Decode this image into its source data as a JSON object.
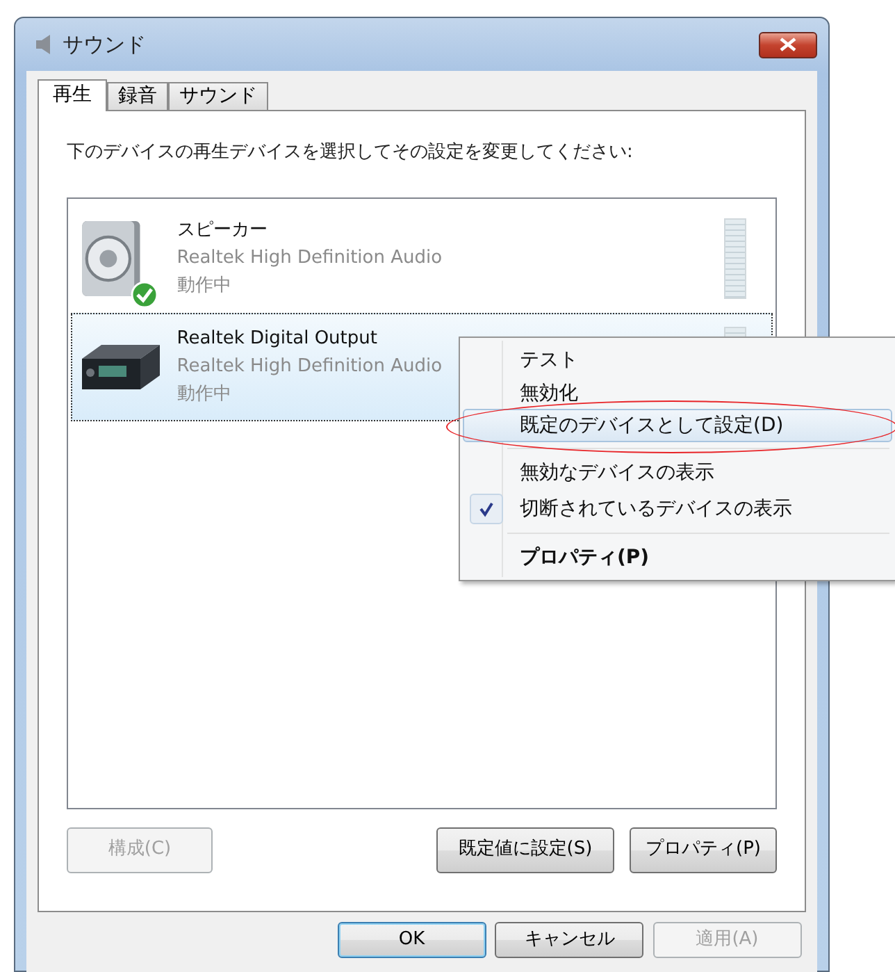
{
  "window": {
    "title": "サウンド"
  },
  "tabs": [
    {
      "label": "再生",
      "selected": true
    },
    {
      "label": "録音",
      "selected": false
    },
    {
      "label": "サウンド",
      "selected": false
    }
  ],
  "instruction": "下のデバイスの再生デバイスを選択してその設定を変更してください:",
  "devices": [
    {
      "kind": "speaker",
      "name": "スピーカー",
      "driver": "Realtek High Definition Audio",
      "status": "動作中",
      "default": true,
      "selected": false
    },
    {
      "kind": "digital-output",
      "name": "Realtek Digital Output",
      "driver": "Realtek High Definition Audio",
      "status": "動作中",
      "default": false,
      "selected": true
    }
  ],
  "device_buttons": [
    {
      "label": "構成(C)",
      "disabled": true
    },
    {
      "label": "既定値に設定(S)",
      "disabled": false
    },
    {
      "label": "プロパティ(P)",
      "disabled": false
    }
  ],
  "dialog_buttons": [
    {
      "label": "OK",
      "default": true,
      "disabled": false
    },
    {
      "label": "キャンセル",
      "default": false,
      "disabled": false
    },
    {
      "label": "適用(A)",
      "default": false,
      "disabled": true
    }
  ],
  "context_menu": {
    "items": [
      {
        "kind": "item",
        "label": "テスト",
        "highlighted": false,
        "circled": false,
        "checked": false,
        "bold": false
      },
      {
        "kind": "item",
        "label": "無効化",
        "highlighted": false,
        "circled": false,
        "checked": false,
        "bold": false
      },
      {
        "kind": "item",
        "label": "既定のデバイスとして設定(D)",
        "highlighted": true,
        "circled": true,
        "checked": false,
        "bold": false
      },
      {
        "kind": "separator"
      },
      {
        "kind": "item",
        "label": "無効なデバイスの表示",
        "highlighted": false,
        "circled": false,
        "checked": false,
        "bold": false
      },
      {
        "kind": "item",
        "label": "切断されているデバイスの表示",
        "highlighted": false,
        "circled": false,
        "checked": true,
        "bold": false
      },
      {
        "kind": "separator"
      },
      {
        "kind": "item",
        "label": "プロパティ(P)",
        "highlighted": false,
        "circled": false,
        "checked": false,
        "bold": true
      }
    ]
  }
}
